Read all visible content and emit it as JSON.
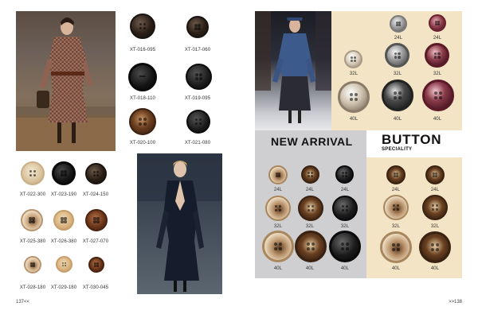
{
  "left_page": {
    "page_number": "137<<",
    "top_grid": [
      {
        "code": "XT-016-095",
        "style": "dark-gloss"
      },
      {
        "code": "XT-017-060",
        "style": "dark-gloss"
      },
      {
        "code": "XT-018-110",
        "style": "black-rim"
      },
      {
        "code": "XT-019-095",
        "style": "dark-gloss"
      },
      {
        "code": "XT-020-100",
        "style": "tortoise"
      },
      {
        "code": "XT-021-080",
        "style": "dark-gloss"
      }
    ],
    "bottom_grid": [
      {
        "code": "XT-022-300",
        "style": "cream"
      },
      {
        "code": "XT-023-190",
        "style": "black-rim"
      },
      {
        "code": "XT-024-150",
        "style": "dark-gloss"
      },
      {
        "code": "XT-025-380",
        "style": "cream-mottled"
      },
      {
        "code": "XT-026-380",
        "style": "tan"
      },
      {
        "code": "XT-027-070",
        "style": "brown-horn"
      },
      {
        "code": "XT-028-180",
        "style": "cream-mottled"
      },
      {
        "code": "XT-029-180",
        "style": "tan"
      },
      {
        "code": "XT-030-045",
        "style": "brown-horn"
      }
    ]
  },
  "right_page": {
    "page_number": ">>138",
    "heading_new_arrival": "NEW ARRIVAL",
    "heading_button": "BUTTON",
    "heading_speciality": "SPECIALITY",
    "top_right_grid": [
      {
        "size": "24L",
        "style": "pearl-gray"
      },
      {
        "size": "24L",
        "style": "wine"
      },
      {
        "size": "32L",
        "style": "pearl-cream"
      },
      {
        "size": "32L",
        "style": "pearl-gray"
      },
      {
        "size": "32L",
        "style": "wine"
      },
      {
        "size": "40L",
        "style": "pearl-cream"
      },
      {
        "size": "40L",
        "style": "pearl-black"
      },
      {
        "size": "40L",
        "style": "wine"
      }
    ],
    "gray_grid": [
      {
        "size": "24L",
        "style": "tortoise-light"
      },
      {
        "size": "24L",
        "style": "tortoise-dark"
      },
      {
        "size": "24L",
        "style": "black-rim"
      },
      {
        "size": "32L",
        "style": "tortoise-light"
      },
      {
        "size": "32L",
        "style": "tortoise-dark"
      },
      {
        "size": "32L",
        "style": "black-rim"
      },
      {
        "size": "40L",
        "style": "tortoise-light"
      },
      {
        "size": "40L",
        "style": "tortoise-dark"
      },
      {
        "size": "40L",
        "style": "black-rim"
      }
    ],
    "beige_grid": [
      {
        "size": "24L",
        "style": "tortoise-dark"
      },
      {
        "size": "24L",
        "style": "tortoise-dark"
      },
      {
        "size": "32L",
        "style": "tortoise-light"
      },
      {
        "size": "32L",
        "style": "tortoise-dark"
      },
      {
        "size": "40L",
        "style": "tortoise-light"
      },
      {
        "size": "40L",
        "style": "tortoise-dark"
      }
    ]
  },
  "colors": {
    "beige_panel": "#f2e4c4",
    "gray_panel": "#cfcfd1"
  }
}
